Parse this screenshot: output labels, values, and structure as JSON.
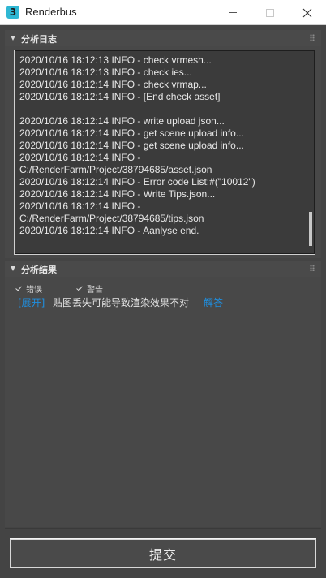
{
  "window": {
    "title": "Renderbus",
    "icon_glyph": "3",
    "icon_color": "#2fb7d3"
  },
  "log_panel": {
    "title": "分析日志",
    "lines": [
      "2020/10/16 18:12:13 INFO - check vrmesh...",
      "2020/10/16 18:12:13 INFO - check ies...",
      "2020/10/16 18:12:14 INFO - check vrmap...",
      "2020/10/16 18:12:14 INFO - [End check asset]",
      "",
      "2020/10/16 18:12:14 INFO - write upload json...",
      "2020/10/16 18:12:14 INFO - get scene upload info...",
      "2020/10/16 18:12:14 INFO - get scene upload info...",
      "2020/10/16 18:12:14 INFO -",
      "C:/RenderFarm/Project/38794685/asset.json",
      "2020/10/16 18:12:14 INFO - Error code List:#(\"10012\")",
      "2020/10/16 18:12:14 INFO - Write Tips.json...",
      "2020/10/16 18:12:14 INFO -",
      "C:/RenderFarm/Project/38794685/tips.json",
      "2020/10/16 18:12:14 INFO - Aanlyse end."
    ]
  },
  "result_panel": {
    "title": "分析结果",
    "filters": [
      {
        "label": "错误",
        "checked": true
      },
      {
        "label": "警告",
        "checked": true
      }
    ],
    "expand_label": "[展开]",
    "message": "贴图丢失可能导致渲染效果不对",
    "answer_label": "解答"
  },
  "submit_label": "提交",
  "colors": {
    "link": "#1f8fe0",
    "background": "#444444"
  }
}
